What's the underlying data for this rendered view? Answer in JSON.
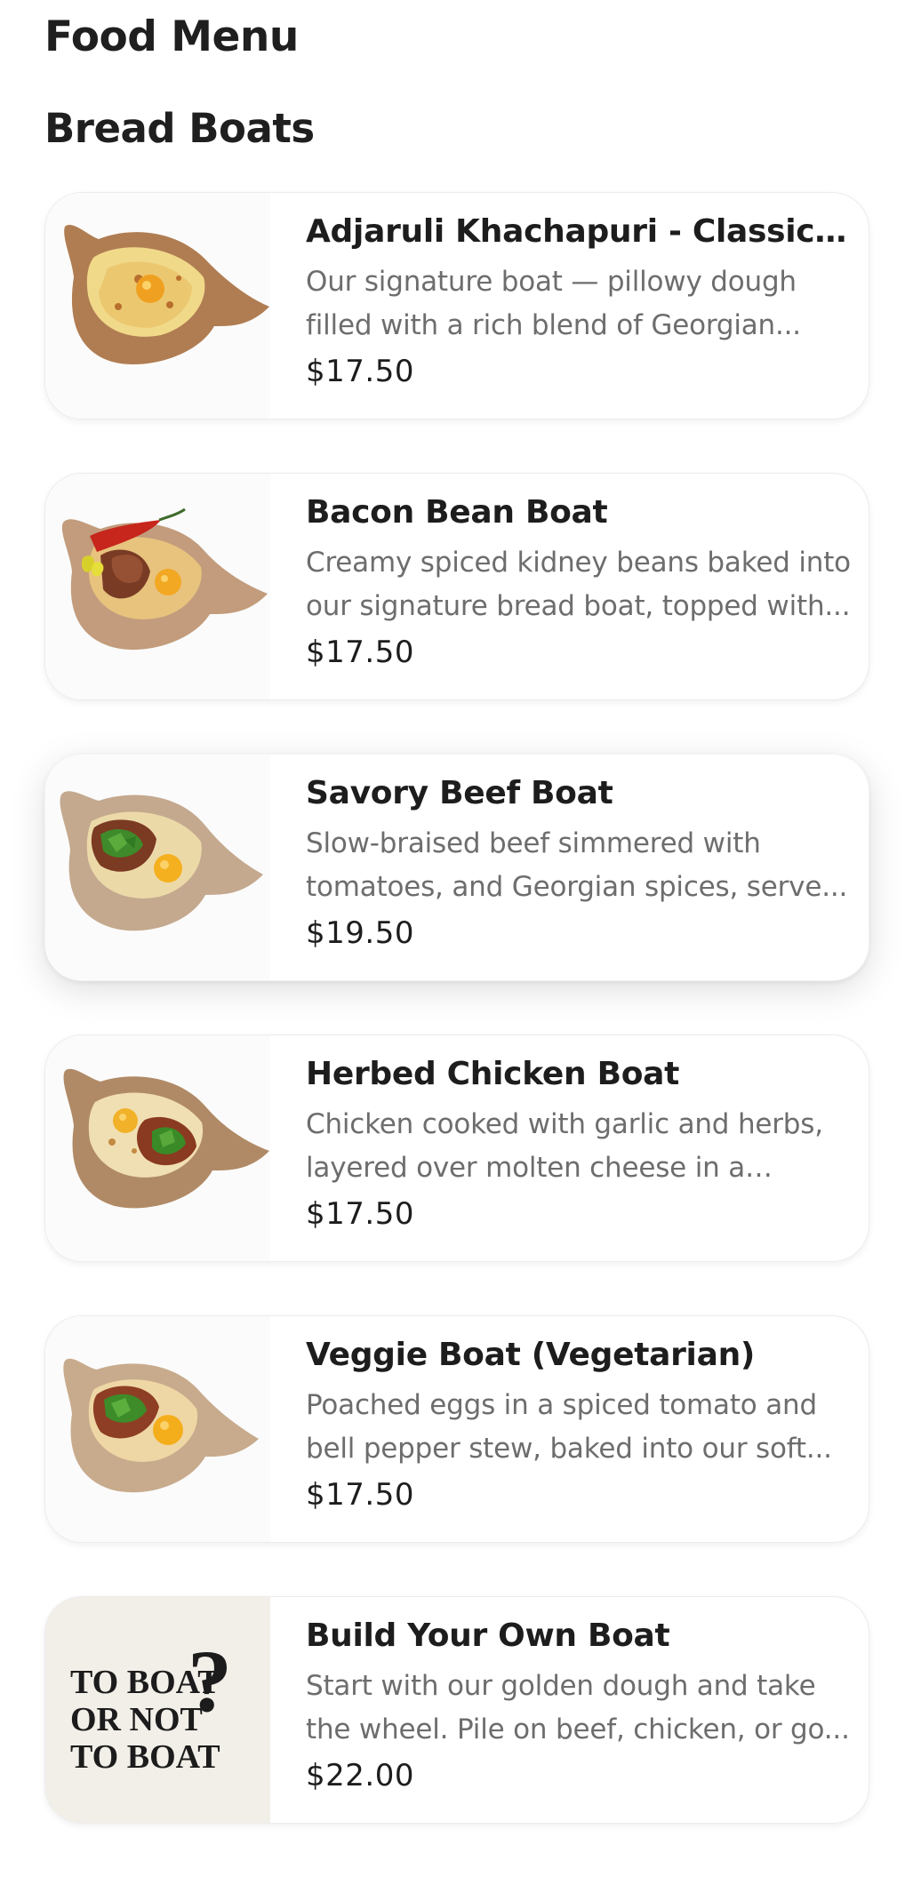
{
  "page": {
    "title": "Food Menu"
  },
  "section": {
    "title": "Bread Boats"
  },
  "items": [
    {
      "name": "Adjaruli Khachapuri - Classic ...",
      "description": "Our signature boat — pillowy dough filled with a rich blend of Georgian...",
      "price": "$17.50",
      "image": "classic-khachapuri-image"
    },
    {
      "name": "Bacon Bean Boat",
      "description": "Creamy spiced kidney beans baked into our signature bread boat, topped with...",
      "price": "$17.50",
      "image": "bacon-bean-boat-image"
    },
    {
      "name": "Savory Beef Boat",
      "description": "Slow-braised beef simmered with tomatoes, and Georgian spices, serve...",
      "price": "$19.50",
      "image": "savory-beef-boat-image"
    },
    {
      "name": "Herbed Chicken Boat",
      "description": "Chicken cooked with garlic and herbs, layered over molten cheese in a warm,...",
      "price": "$17.50",
      "image": "herbed-chicken-boat-image"
    },
    {
      "name": "Veggie Boat (Vegetarian)",
      "description": "Poached eggs in a spiced tomato and bell pepper stew, baked into our soft...",
      "price": "$17.50",
      "image": "veggie-boat-image"
    },
    {
      "name": "Build Your Own Boat",
      "description": "Start with our golden dough and take the wheel. Pile on beef, chicken, or go...",
      "price": "$22.00",
      "image": "to-boat-poster-image",
      "poster_text": [
        "TO BOAT",
        "OR NOT",
        "TO BOAT",
        "?"
      ]
    }
  ]
}
